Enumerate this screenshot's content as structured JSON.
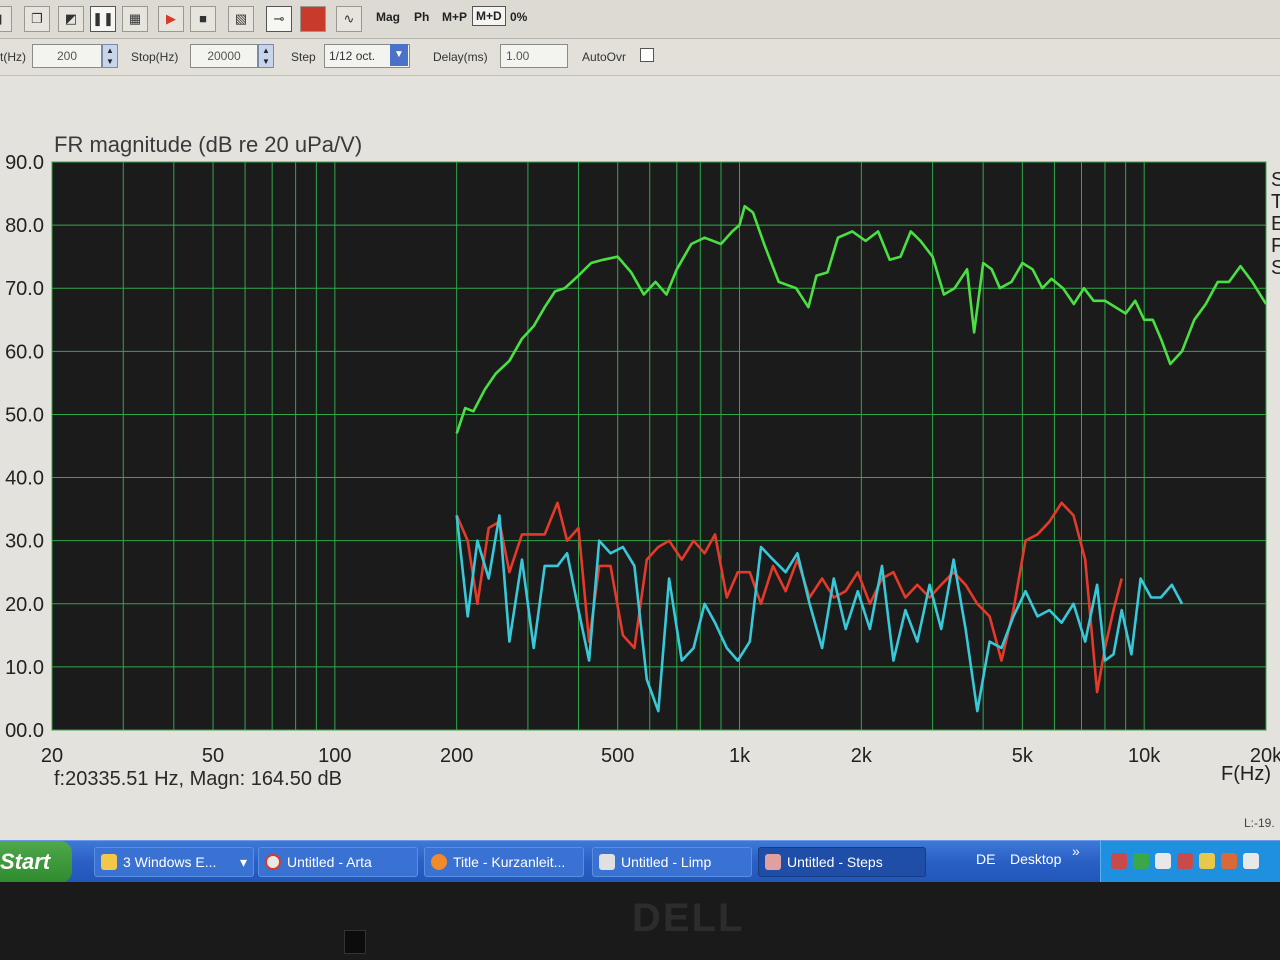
{
  "toolbar": {
    "mag_label": "Mag",
    "ph_label": "Ph",
    "mp_label": "M+P",
    "md_label": "M+D",
    "pct_label": "0%"
  },
  "params": {
    "start_label": "t(Hz)",
    "start_value": "200",
    "stop_label": "Stop(Hz)",
    "stop_value": "20000",
    "step_label": "Step",
    "step_value": "1/12 oct.",
    "delay_label": "Delay(ms)",
    "delay_value": "1.00",
    "autoovr_label": "AutoOvr"
  },
  "plot": {
    "title": "FR magnitude (dB re 20 uPa/V)",
    "cursor_readout": "f:20335.51 Hz, Magn: 164.50 dB",
    "status_right": "L:-19.",
    "right_letters": [
      "S",
      "T",
      "E",
      "F",
      "S"
    ]
  },
  "chart_data": {
    "type": "line",
    "xscale": "log",
    "xlim": [
      20,
      20000
    ],
    "ylim": [
      0,
      90
    ],
    "grid": true,
    "xlabel": "F(Hz)",
    "ylabel": "",
    "y_tick_labels": [
      "90.0",
      "80.0",
      "70.0",
      "60.0",
      "50.0",
      "40.0",
      "30.0",
      "20.0",
      "10.0",
      "00.0"
    ],
    "y_tick_values": [
      90,
      80,
      70,
      60,
      50,
      40,
      30,
      20,
      10,
      0
    ],
    "x_tick_labels": [
      "20",
      "50",
      "100",
      "200",
      "500",
      "1k",
      "2k",
      "5k",
      "10k",
      "20k"
    ],
    "x_tick_values": [
      20,
      50,
      100,
      200,
      500,
      1000,
      2000,
      5000,
      10000,
      20000
    ],
    "colors": {
      "background": "#1b1b1b",
      "grid": "#2fa84a",
      "green": "#4be042",
      "red": "#e43a2a",
      "cyan": "#38c8d8"
    },
    "series": [
      {
        "color": "#4be042",
        "x": [
          200,
          210,
          220,
          235,
          250,
          270,
          290,
          310,
          330,
          350,
          370,
          400,
          430,
          460,
          500,
          540,
          580,
          620,
          660,
          700,
          760,
          820,
          900,
          960,
          1000,
          1030,
          1080,
          1150,
          1250,
          1380,
          1480,
          1550,
          1650,
          1750,
          1900,
          2050,
          2200,
          2350,
          2500,
          2650,
          2800,
          3000,
          3200,
          3400,
          3650,
          3800,
          4000,
          4200,
          4400,
          4700,
          5000,
          5300,
          5600,
          5900,
          6300,
          6700,
          7100,
          7500,
          8000,
          8500,
          9000,
          9500,
          10000,
          10500,
          11000,
          11600,
          12400,
          13300,
          14200,
          15200,
          16200,
          17300,
          18500,
          20000
        ],
        "y": [
          47,
          51,
          50.5,
          54,
          56.5,
          58.5,
          62,
          64,
          67,
          69.5,
          70,
          72,
          74,
          74.5,
          75,
          72.5,
          69,
          71,
          69,
          73,
          77,
          78,
          77,
          79,
          80,
          83,
          82,
          77,
          71,
          70,
          67,
          72,
          72.5,
          78,
          79,
          77.5,
          79,
          74.5,
          75,
          79,
          77.5,
          75,
          69,
          70,
          73,
          63,
          74,
          73,
          70,
          71,
          74,
          73,
          70,
          71.5,
          70,
          67.5,
          70,
          68,
          68,
          67,
          66,
          68,
          65,
          65,
          62,
          58,
          60,
          65,
          67.5,
          71,
          71,
          73.5,
          71,
          67.5
        ]
      },
      {
        "color": "#e43a2a",
        "x": [
          200,
          213,
          225,
          240,
          255,
          270,
          290,
          310,
          330,
          355,
          375,
          400,
          425,
          450,
          480,
          515,
          550,
          590,
          630,
          670,
          720,
          770,
          820,
          870,
          930,
          990,
          1060,
          1130,
          1210,
          1300,
          1390,
          1490,
          1600,
          1710,
          1830,
          1960,
          2100,
          2250,
          2400,
          2570,
          2750,
          2950,
          3150,
          3380,
          3620,
          3870,
          4150,
          4440,
          4750,
          5090,
          5450,
          5830,
          6250,
          6690,
          7150,
          7650,
          8000,
          8400,
          8800
        ],
        "y": [
          34,
          30,
          20,
          32,
          33,
          25,
          31,
          31,
          31,
          36,
          30,
          32,
          14,
          26,
          26,
          15,
          13,
          27,
          29,
          30,
          27,
          30,
          28,
          31,
          21,
          25,
          25,
          20,
          26,
          22,
          27,
          21,
          24,
          21,
          22,
          25,
          20,
          24,
          25,
          21,
          23,
          21,
          23,
          25,
          23,
          20,
          18,
          11,
          19,
          30,
          31,
          33,
          36,
          34,
          27,
          6,
          13,
          19,
          24
        ]
      },
      {
        "color": "#38c8d8",
        "x": [
          200,
          213,
          225,
          240,
          255,
          270,
          290,
          310,
          330,
          355,
          375,
          400,
          425,
          450,
          480,
          515,
          550,
          590,
          630,
          670,
          720,
          770,
          820,
          870,
          930,
          990,
          1060,
          1130,
          1210,
          1300,
          1390,
          1490,
          1600,
          1710,
          1830,
          1960,
          2100,
          2250,
          2400,
          2570,
          2750,
          2950,
          3150,
          3380,
          3620,
          3870,
          4150,
          4440,
          4750,
          5090,
          5450,
          5830,
          6250,
          6690,
          7150,
          7650,
          8000,
          8400,
          8800,
          9300,
          9800,
          10400,
          11000,
          11700,
          12400
        ],
        "y": [
          34,
          18,
          30,
          24,
          34,
          14,
          27,
          13,
          26,
          26,
          28,
          19,
          11,
          30,
          28,
          29,
          26,
          8,
          3,
          24,
          11,
          13,
          20,
          17,
          13,
          11,
          14,
          29,
          27,
          25,
          28,
          20,
          13,
          24,
          16,
          22,
          16,
          26,
          11,
          19,
          14,
          23,
          16,
          27,
          16,
          3,
          14,
          13,
          18,
          22,
          18,
          19,
          17,
          20,
          14,
          23,
          11,
          12,
          19,
          12,
          24,
          21,
          21,
          23,
          20
        ]
      }
    ]
  },
  "taskbar": {
    "start_label": "Start",
    "items": [
      "3 Windows E...",
      "Untitled - Arta",
      "Title - Kurzanleit...",
      "Untitled - Limp",
      "Untitled - Steps"
    ],
    "lang": "DE",
    "desktop": "Desktop",
    "chevron": "»"
  },
  "brand": "DELL"
}
